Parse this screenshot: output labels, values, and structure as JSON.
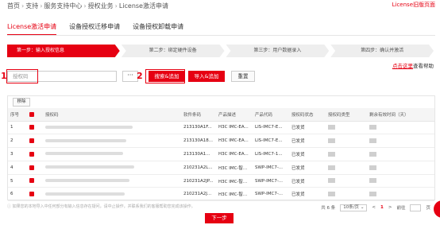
{
  "breadcrumb": [
    "首页",
    "支持",
    "服务支持中心",
    "授权业务",
    "License激活申请"
  ],
  "old_page_link": "License旧版页面",
  "tabs": [
    "License激活申请",
    "设备授权迁移申请",
    "设备授权卸载申请"
  ],
  "steps": [
    "第一步：输入授权信息",
    "第二步：绑定硬件设备",
    "第三步：用户数据录入",
    "第四步：确认并激活"
  ],
  "help": {
    "link": "点击这里",
    "text": "查看帮助"
  },
  "search": {
    "placeholder": "授权码",
    "more_label": "···",
    "search_add_label": "搜索&追加",
    "import_add_label": "导入&追加",
    "reset_label": "重置",
    "annotation_1": "1",
    "annotation_2": "2"
  },
  "table": {
    "remove_label": "移除",
    "columns": [
      "序号",
      "",
      "授权码",
      "软件条码",
      "产品描述",
      "产品代码",
      "授权码状态",
      "授权码类型",
      "剩余有效时间（天）"
    ],
    "rows": [
      {
        "no": "1",
        "barcode": "213130A1F...",
        "desc": "H3C IMC-EA...",
        "code": "LIS-IMC7-E...",
        "status": "已发货"
      },
      {
        "no": "2",
        "barcode": "213130A18...",
        "desc": "H3C IMC-EA...",
        "code": "LIS-IMC7-E...",
        "status": "已发货"
      },
      {
        "no": "3",
        "barcode": "213130A1...",
        "desc": "H3C IMC-EA...",
        "code": "LIS-IMC7-1...",
        "status": "已发货"
      },
      {
        "no": "4",
        "barcode": "210231A2L...",
        "desc": "H3C IMC-智...",
        "code": "SWP-IMC7-...",
        "status": "已发货"
      },
      {
        "no": "5",
        "barcode": "210231A2JP...",
        "desc": "H3C IMC-智...",
        "code": "SWP-IMC7-...",
        "status": "已发货"
      },
      {
        "no": "6",
        "barcode": "210231A2J...",
        "desc": "H3C IMC-智...",
        "code": "SWP-IMC7-...",
        "status": "已发货"
      }
    ]
  },
  "note": "如果您的本地导入中任何部分有输入信息存在疑问，请中止操作，并联系我们的客服帮助您完成该操作。",
  "pager": {
    "total": "共 6 条",
    "size": "10条/页",
    "prev": "<",
    "current": "1",
    "next": ">",
    "goto": "前往",
    "page_unit": "页"
  },
  "next_label": "下一步",
  "colors": {
    "accent": "#e60012"
  }
}
